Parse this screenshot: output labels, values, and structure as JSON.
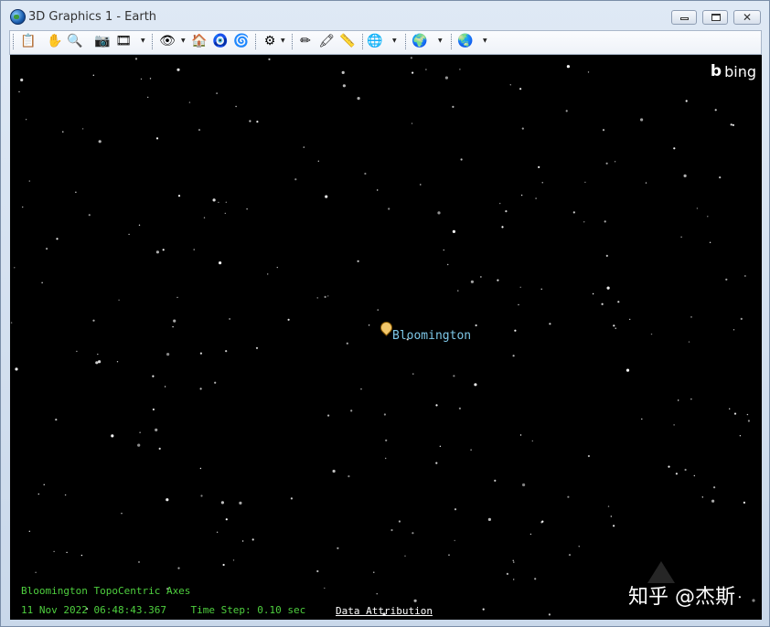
{
  "window": {
    "title": "3D Graphics 1 - Earth"
  },
  "window_buttons": {
    "minimize": "minimize",
    "maximize": "maximize",
    "close": "close"
  },
  "toolbar": {
    "tools": [
      {
        "name": "properties-icon",
        "glyph": "📋"
      },
      {
        "name": "pan-hand-icon",
        "glyph": "✋"
      },
      {
        "name": "zoom-icon",
        "glyph": "🔍"
      },
      {
        "name": "snapshot-icon",
        "glyph": "📷"
      },
      {
        "name": "record-movie-icon",
        "glyph": "🎞"
      },
      {
        "name": "view-from-icon",
        "glyph": "👁"
      },
      {
        "name": "home-view-icon",
        "glyph": "🏠"
      },
      {
        "name": "view-center-icon",
        "glyph": "🧿"
      },
      {
        "name": "view-orbit-icon",
        "glyph": "🌀"
      },
      {
        "name": "view-options-icon",
        "glyph": "⚙"
      },
      {
        "name": "draw-line-icon",
        "glyph": "✏"
      },
      {
        "name": "eraser-icon",
        "glyph": "🖍"
      },
      {
        "name": "measure-icon",
        "glyph": "📏"
      },
      {
        "name": "globe-grid-icon",
        "glyph": "🌐"
      },
      {
        "name": "globe-map-icon",
        "glyph": "🌍"
      },
      {
        "name": "globe-terrain-icon",
        "glyph": "🌏"
      }
    ]
  },
  "viewport": {
    "logo": {
      "mark": "b",
      "text": "bing"
    },
    "object_label": "Bloomington",
    "axes_label": "Bloomington TopoCentric Axes",
    "timestamp": "11 Nov 2022 06:48:43.367",
    "time_step": "Time Step: 0.10 sec",
    "attribution": "Data Attribution",
    "watermark": "知乎 @杰斯"
  },
  "colors": {
    "hud_text": "#4ecf3e",
    "label_text": "#7ec8e8",
    "background": "#000000"
  }
}
